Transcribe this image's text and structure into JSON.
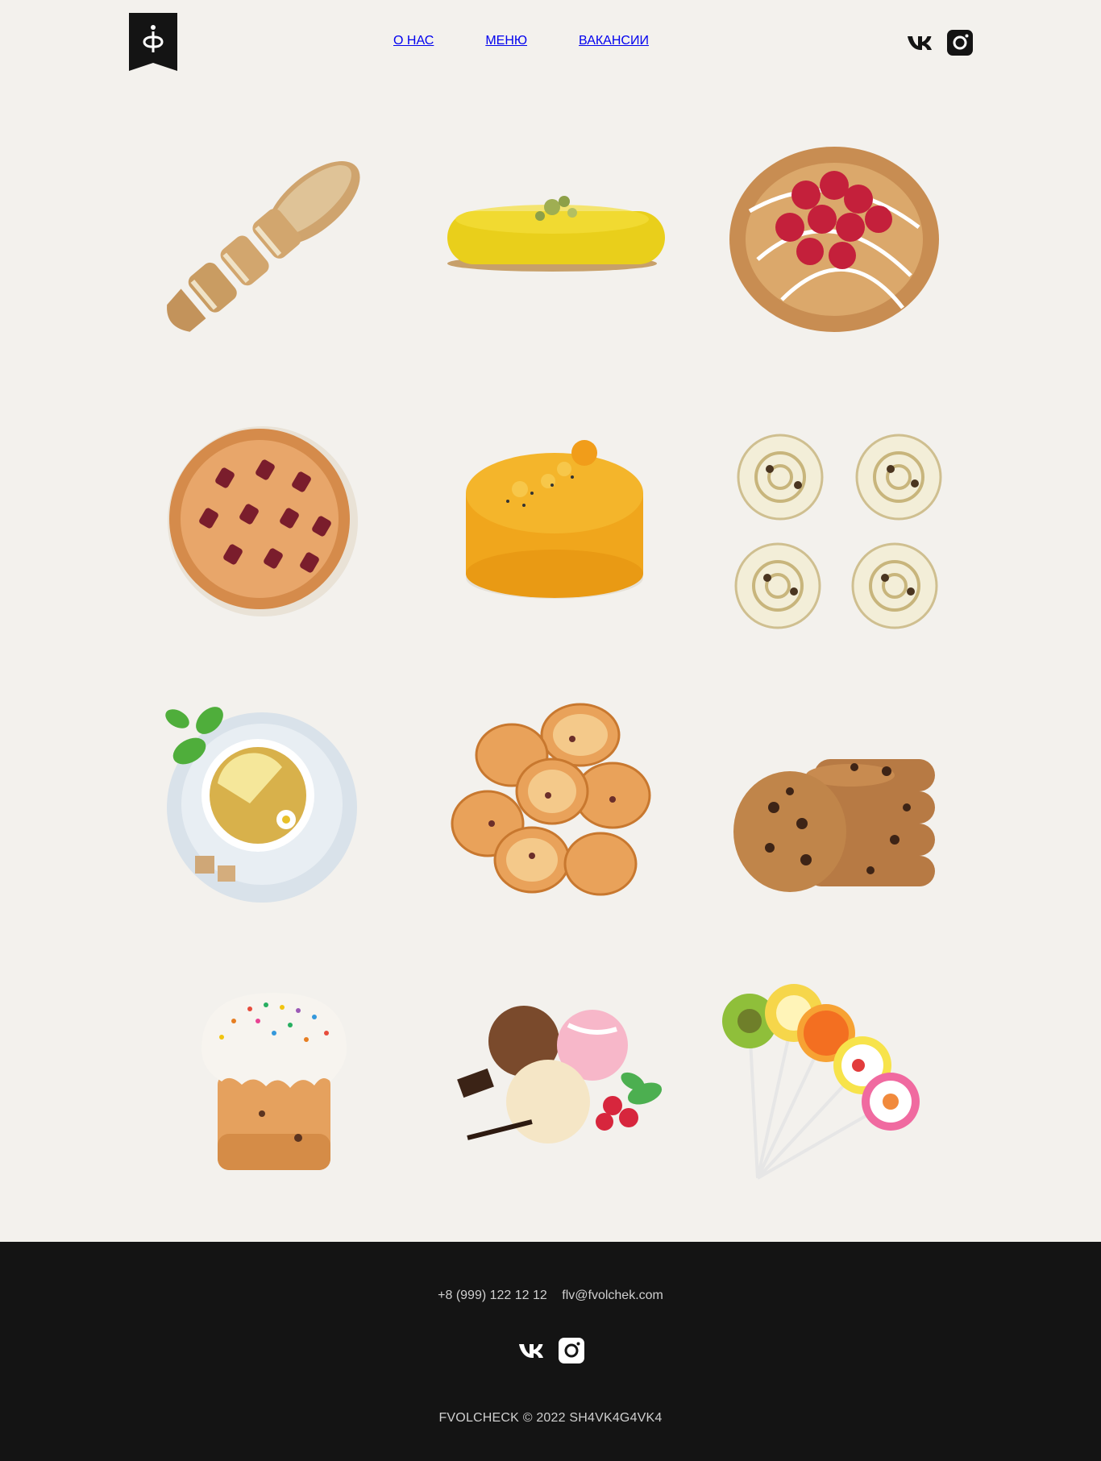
{
  "header": {
    "logo_icon": "fvolchek-logo-icon",
    "nav": [
      {
        "label": "О НАС",
        "active": false
      },
      {
        "label": "МЕНЮ",
        "active": true
      },
      {
        "label": "ВАКАНСИИ",
        "active": false
      }
    ],
    "social": [
      "vk-icon",
      "instagram-icon"
    ]
  },
  "menu_items": [
    {
      "icon": "baguette-image"
    },
    {
      "icon": "eclair-image"
    },
    {
      "icon": "raspberry-danish-image"
    },
    {
      "icon": "cherry-pie-image"
    },
    {
      "icon": "mango-mousse-cake-image"
    },
    {
      "icon": "cinnamon-rolls-image"
    },
    {
      "icon": "lemon-tea-image"
    },
    {
      "icon": "rusks-image"
    },
    {
      "icon": "chocolate-chip-cookies-image"
    },
    {
      "icon": "easter-cake-image"
    },
    {
      "icon": "ice-cream-image"
    },
    {
      "icon": "lollipops-image"
    }
  ],
  "footer": {
    "phone": "+8 (999) 122 12 12",
    "email": "flv@fvolchek.com",
    "copyright": "FVOLCHECK © 2022 SH4VK4G4VK4"
  },
  "colors": {
    "background": "#f3f1ed",
    "footer_bg": "#141414",
    "text_dark": "#222222",
    "footer_text": "#cfcfcf"
  }
}
